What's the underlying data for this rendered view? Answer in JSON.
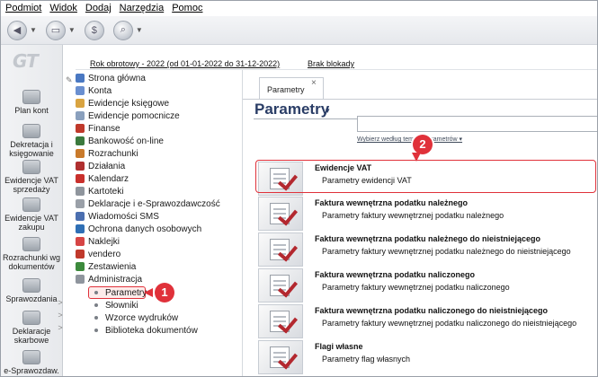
{
  "menubar": {
    "items": [
      "Podmiot",
      "Widok",
      "Dodaj",
      "Narzędzia",
      "Pomoc"
    ]
  },
  "toolbar": {
    "buttons": [
      {
        "icon": "back-arrow-icon"
      },
      {
        "icon": "document-icon"
      },
      {
        "icon": "money-icon"
      },
      {
        "icon": "search-icon"
      }
    ]
  },
  "leftbar": {
    "logo": "GT",
    "items": [
      "Plan kont",
      "Dekretacja i księgowanie",
      "Ewidencje VAT sprzedaży",
      "Ewidencje VAT zakupu",
      "Rozrachunki wg dokumentów",
      "Sprawozdania",
      "Deklaracje skarbowe",
      "e-Sprawozdaw."
    ],
    "chevrons": [
      ">",
      ">",
      ">"
    ]
  },
  "yearbar": {
    "year_text": "Rok obrotowy - 2022  (od 01-01-2022 do 31-12-2022)",
    "block_text": "Brak blokady"
  },
  "nav": {
    "items": [
      {
        "label": "Strona główna",
        "color": "#4a78c2"
      },
      {
        "label": "Konta",
        "color": "#6a8fd0"
      },
      {
        "label": "Ewidencje księgowe",
        "color": "#d9a441"
      },
      {
        "label": "Ewidencje pomocnicze",
        "color": "#8aa0bd"
      },
      {
        "label": "Finanse",
        "color": "#c0392b"
      },
      {
        "label": "Bankowość on-line",
        "color": "#3b7a3e"
      },
      {
        "label": "Rozrachunki",
        "color": "#c97a2b"
      },
      {
        "label": "Działania",
        "color": "#b03030"
      },
      {
        "label": "Kalendarz",
        "color": "#c9302c"
      },
      {
        "label": "Kartoteki",
        "color": "#8f959d"
      },
      {
        "label": "Deklaracje i e-Sprawozdawczość",
        "color": "#9aa0a8"
      },
      {
        "label": "Wiadomości SMS",
        "color": "#4b6fb0"
      },
      {
        "label": "Ochrona danych osobowych",
        "color": "#2f6fb5"
      },
      {
        "label": "Naklejki",
        "color": "#d64545"
      },
      {
        "label": "vendero",
        "color": "#c0392b"
      },
      {
        "label": "Zestawienia",
        "color": "#3c8a3c"
      },
      {
        "label": "Administracja",
        "color": "#8f959d"
      }
    ],
    "subitems": [
      "Parametry",
      "Słowniki",
      "Wzorce wydruków",
      "Biblioteka dokumentów"
    ]
  },
  "tab": {
    "label": "Parametry",
    "close": "×"
  },
  "page": {
    "title": "Parametry",
    "title_caret": "▾",
    "search_placeholder": "",
    "filter_link": "Wybierz według tematu parametrów ▾"
  },
  "rows": [
    {
      "title": "Ewidencje VAT",
      "sub": "Parametry ewidencji VAT"
    },
    {
      "title": "Faktura wewnętrzna podatku należnego",
      "sub": "Parametry faktury wewnętrznej podatku należnego"
    },
    {
      "title": "Faktura wewnętrzna podatku należnego do nieistniejącego",
      "sub": "Parametry faktury wewnętrznej podatku należnego do nieistniejącego"
    },
    {
      "title": "Faktura wewnętrzna podatku naliczonego",
      "sub": "Parametry faktury wewnętrznej podatku naliczonego"
    },
    {
      "title": "Faktura wewnętrzna podatku naliczonego do nieistniejącego",
      "sub": "Parametry faktury wewnętrznej podatku naliczonego do nieistniejącego"
    },
    {
      "title": "Flagi własne",
      "sub": "Parametry flag własnych"
    }
  ],
  "callouts": {
    "first": "1",
    "second": "2"
  },
  "colors": {
    "accent": "#e0313a",
    "title": "#2a3d66"
  }
}
